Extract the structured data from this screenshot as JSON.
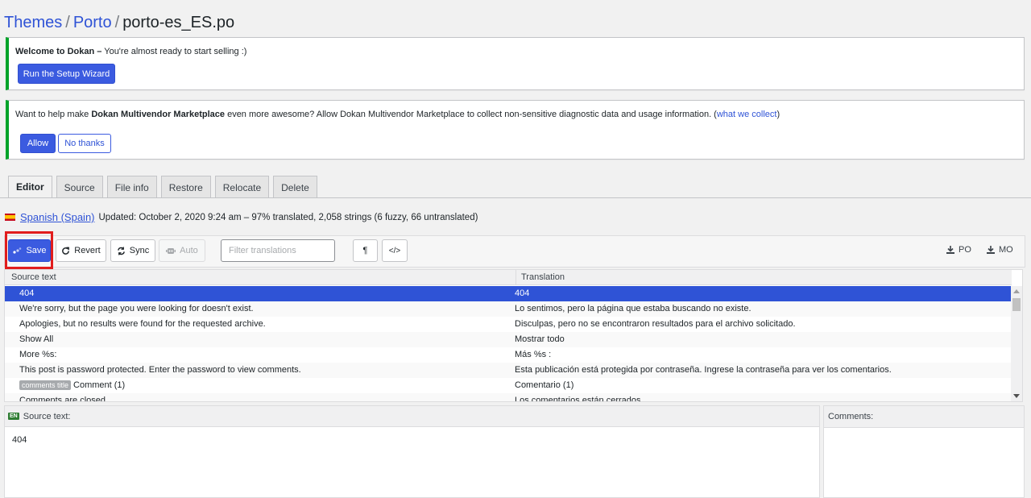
{
  "breadcrumb": {
    "items": [
      "Themes",
      "Porto"
    ],
    "separator": "/",
    "current": "porto-es_ES.po"
  },
  "welcome_notice": {
    "bold": "Welcome to Dokan –",
    "text": " You're almost ready to start selling :)",
    "button": "Run the Setup Wizard"
  },
  "tracking_notice": {
    "pre": "Want to help make ",
    "bold": "Dokan Multivendor Marketplace",
    "post": " even more awesome? Allow Dokan Multivendor Marketplace to collect non-sensitive diagnostic data and usage information. (",
    "link": "what we collect",
    "close": ")",
    "allow": "Allow",
    "no_thanks": "No thanks"
  },
  "tabs": [
    "Editor",
    "Source",
    "File info",
    "Restore",
    "Relocate",
    "Delete"
  ],
  "active_tab": "Editor",
  "language": {
    "name": "Spanish (Spain)",
    "status": "Updated: October 2, 2020 9:24 am – 97% translated, 2,058 strings (6 fuzzy, 66 untranslated)"
  },
  "toolbar": {
    "save": "Save",
    "revert": "Revert",
    "sync": "Sync",
    "auto": "Auto",
    "filter_placeholder": "Filter translations",
    "pilcrow": "¶",
    "code": "</>",
    "po": "PO",
    "mo": "MO"
  },
  "grid": {
    "col_source": "Source text",
    "col_translation": "Translation",
    "rows": [
      {
        "ctx": "",
        "src": "404",
        "tr": "404",
        "selected": true
      },
      {
        "ctx": "",
        "src": "We're sorry, but the page you were looking for doesn't exist.",
        "tr": "Lo sentimos, pero la página que estaba buscando no existe."
      },
      {
        "ctx": "",
        "src": "Apologies, but no results were found for the requested archive.",
        "tr": "Disculpas, pero no se encontraron resultados para el archivo solicitado."
      },
      {
        "ctx": "",
        "src": "Show All",
        "tr": "Mostrar todo"
      },
      {
        "ctx": "",
        "src": "More %s:",
        "tr": "Más %s :"
      },
      {
        "ctx": "",
        "src": "This post is password protected. Enter the password to view comments.",
        "tr": "Esta publicación está protegida por contraseña. Ingrese la contraseña para ver los comentarios."
      },
      {
        "ctx": "comments title",
        "src": "Comment (1)",
        "tr": "Comentario (1)"
      },
      {
        "ctx": "",
        "src": "Comments are closed.",
        "tr": "Los comentarios están cerrados."
      }
    ]
  },
  "source_panel": {
    "badge": "EN",
    "label": "Source text:",
    "value": "404"
  },
  "comments_panel": {
    "label": "Comments:"
  },
  "colors": {
    "primary": "#3b5be0",
    "link": "#2f53d6",
    "selected_row": "#2f53d6",
    "notice_border": "#00a32a",
    "highlight": "#e11d1d"
  }
}
